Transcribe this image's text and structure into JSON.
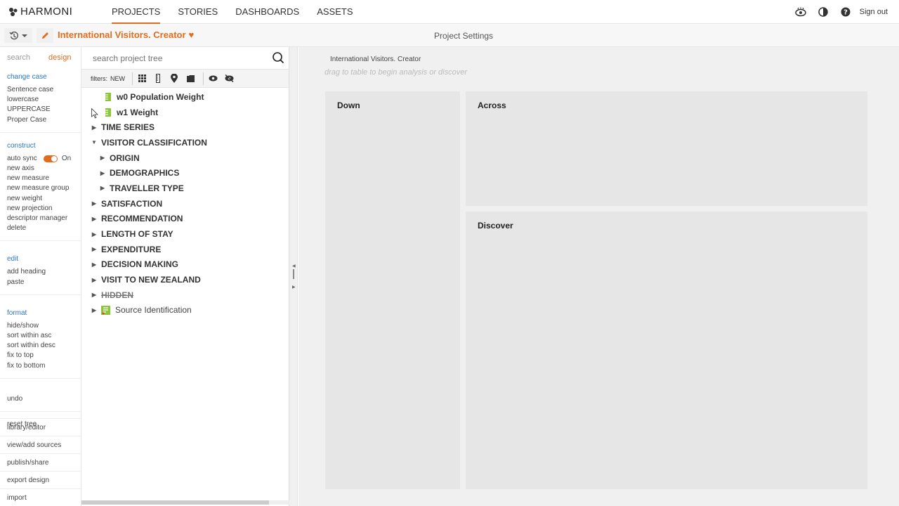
{
  "brand": {
    "name": "HARMONI"
  },
  "nav": {
    "items": [
      "PROJECTS",
      "STORIES",
      "DASHBOARDS",
      "ASSETS"
    ],
    "active": "PROJECTS"
  },
  "header": {
    "sign_out": "Sign out"
  },
  "project": {
    "title": "International Visitors. Creator",
    "settings_title": "Project Settings"
  },
  "left_tabs": {
    "search": "search",
    "design": "design"
  },
  "menu": {
    "change_case": {
      "head": "change case",
      "items": [
        "Sentence case",
        "lowercase",
        "UPPERCASE",
        "Proper Case"
      ]
    },
    "construct": {
      "head": "construct",
      "auto_sync_label": "auto sync",
      "auto_sync_state": "On",
      "items": [
        "new axis",
        "new measure",
        "new measure group",
        "new weight",
        "new projection",
        "descriptor manager",
        "delete"
      ]
    },
    "edit": {
      "head": "edit",
      "items": [
        "add heading",
        "paste"
      ]
    },
    "format": {
      "head": "format",
      "items": [
        "hide/show",
        "sort within asc",
        "sort within desc",
        "fix to top",
        "fix to bottom"
      ]
    },
    "undo": "undo",
    "reset_tree": "reset tree",
    "bottom_links": [
      "library/editor",
      "view/add sources",
      "publish/share",
      "export design",
      "import"
    ]
  },
  "tree_panel": {
    "search_placeholder": "search project tree",
    "filters_label": "filters:",
    "filters_new": "NEW",
    "nodes": [
      {
        "label": "w0 Population Weight",
        "type": "weight"
      },
      {
        "label": "w1 Weight",
        "type": "weight"
      },
      {
        "label": "TIME SERIES",
        "type": "folder"
      },
      {
        "label": "VISITOR CLASSIFICATION",
        "type": "folder-open"
      },
      {
        "label": "ORIGIN",
        "type": "child"
      },
      {
        "label": "DEMOGRAPHICS",
        "type": "child"
      },
      {
        "label": "TRAVELLER TYPE",
        "type": "child"
      },
      {
        "label": "SATISFACTION",
        "type": "folder"
      },
      {
        "label": "RECOMMENDATION",
        "type": "folder"
      },
      {
        "label": "LENGTH OF STAY",
        "type": "folder"
      },
      {
        "label": "EXPENDITURE",
        "type": "folder"
      },
      {
        "label": "DECISION MAKING",
        "type": "folder"
      },
      {
        "label": "VISIT TO NEW ZEALAND",
        "type": "folder"
      },
      {
        "label": "HIDDEN",
        "type": "hidden"
      },
      {
        "label": "Source Identification",
        "type": "source"
      }
    ]
  },
  "workspace": {
    "title": "International Visitors. Creator",
    "hint": "drag to table to begin analysis or discover",
    "panels": {
      "down": "Down",
      "across": "Across",
      "discover": "Discover"
    }
  },
  "colors": {
    "accent": "#e06c1e",
    "link": "#2a76c6",
    "weight_icon": "#8cc43c"
  }
}
